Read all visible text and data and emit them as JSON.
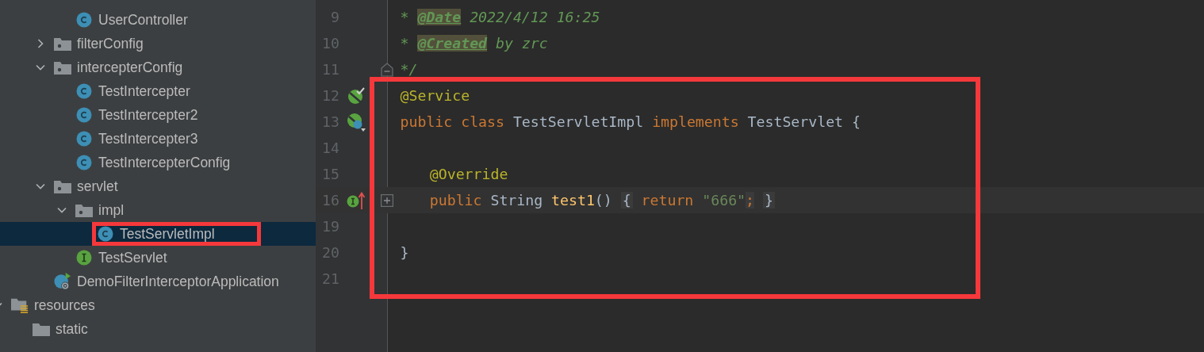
{
  "project_tree": [
    {
      "children": [
        {
          "children": [
            {
              "children": [
                {
                  "label": "UserController",
                  "kind": "class",
                  "selected": false
                }
              ]
            },
            {
              "label": "filterConfig",
              "kind": "package",
              "expanded": false,
              "selected": false
            },
            {
              "label": "intercepterConfig",
              "kind": "package",
              "expanded": true,
              "selected": false,
              "children": [
                {
                  "label": "TestIntercepter",
                  "kind": "class",
                  "selected": false
                },
                {
                  "label": "TestIntercepter2",
                  "kind": "class",
                  "selected": false
                },
                {
                  "label": "TestIntercepter3",
                  "kind": "class",
                  "selected": false
                },
                {
                  "label": "TestIntercepterConfig",
                  "kind": "class",
                  "selected": false
                }
              ]
            },
            {
              "label": "servlet",
              "kind": "package",
              "expanded": true,
              "selected": false,
              "children": [
                {
                  "label": "impl",
                  "kind": "package",
                  "expanded": true,
                  "selected": false,
                  "children": [
                    {
                      "label": "TestServletImpl",
                      "kind": "class",
                      "selected": true,
                      "boxed": true
                    }
                  ]
                },
                {
                  "label": "TestServlet",
                  "kind": "interface",
                  "selected": false
                }
              ]
            },
            {
              "label": "DemoFilterInterceptorApplication",
              "kind": "app",
              "selected": false
            }
          ]
        }
      ]
    },
    {
      "label": "resources",
      "kind": "resources",
      "expanded": true,
      "selected": false,
      "children": [
        {
          "label": "static",
          "kind": "folder",
          "selected": false
        }
      ]
    }
  ],
  "editor": {
    "lines": [
      {
        "number": "9",
        "tokens": [
          {
            "text": "* ",
            "kind": "comment"
          },
          {
            "text": "@Date",
            "kind": "doctag"
          },
          {
            "text": " 2022/4/12 16:25",
            "kind": "comment"
          }
        ]
      },
      {
        "number": "10",
        "tokens": [
          {
            "text": "* ",
            "kind": "comment"
          },
          {
            "text": "@Created",
            "kind": "doctag"
          },
          {
            "text": " by zrc",
            "kind": "comment"
          }
        ]
      },
      {
        "number": "11",
        "fold": {
          "kind": "end"
        },
        "tokens": [
          {
            "text": "*/",
            "kind": "comment"
          }
        ]
      }
    ],
    "framed_block": {
      "lines": [
        {
          "number": "12",
          "gutter_icon": {
            "kind": "bean"
          },
          "tokens": [
            {
              "text": "@Service",
              "kind": "annotation"
            }
          ]
        },
        {
          "number": "13",
          "gutter_icon": {
            "kind": "bean-class"
          },
          "tokens": [
            {
              "text": "public class ",
              "kind": "keyword"
            },
            {
              "text": "TestServletImpl ",
              "kind": "plain"
            },
            {
              "text": "implements ",
              "kind": "keyword"
            },
            {
              "text": "TestServlet {",
              "kind": "plain"
            }
          ]
        },
        {
          "number": "14"
        },
        {
          "number": "15",
          "indented": true,
          "tokens": [
            {
              "text": "@Override",
              "kind": "annotation"
            }
          ]
        },
        {
          "number": "16",
          "current": true,
          "indented": true,
          "gutter_icon": {
            "kind": "implements"
          },
          "fold": {
            "kind": "collapsed"
          },
          "tokens": [
            {
              "text": "public ",
              "kind": "keyword"
            },
            {
              "text": "String ",
              "kind": "plain"
            },
            {
              "text": "test1",
              "kind": "method"
            },
            {
              "text": "() ",
              "kind": "plain"
            },
            {
              "text": "{",
              "kind": "folded"
            },
            {
              "text": " return ",
              "kind": "keyword"
            },
            {
              "text": "\"666\"",
              "kind": "string"
            },
            {
              "text": ";",
              "kind": "folded-keyword"
            },
            {
              "text": "}",
              "kind": "folded"
            }
          ]
        },
        {
          "number": "19"
        },
        {
          "number": "20",
          "tokens": [
            {
              "text": "}",
              "kind": "plain"
            }
          ]
        },
        {
          "number": "21"
        }
      ]
    }
  }
}
